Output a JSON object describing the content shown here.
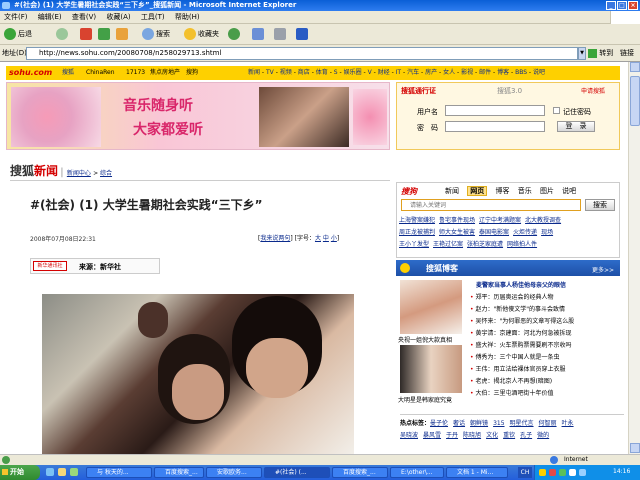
{
  "window": {
    "title": "#(社会) (1) 大学生暑期社会实践“三下乡”_搜狐新闻 - Microsoft Internet Explorer"
  },
  "menu": [
    "文件(F)",
    "编辑(E)",
    "查看(V)",
    "收藏(A)",
    "工具(T)",
    "帮助(H)"
  ],
  "toolbar": {
    "back": "后退",
    "search": "搜索",
    "favorites": "收藏夹"
  },
  "address": {
    "label": "地址(D)",
    "url": "http://news.sohu.com/20080708/n258029713.shtml",
    "go": "转到",
    "links": "链接"
  },
  "sohu": {
    "logo": "sohu.com",
    "search_label": "搜狐",
    "partners": [
      "ChinaRen",
      "17173",
      "焦点房地产",
      "搜狗"
    ],
    "nav": [
      "新闻",
      "TV",
      "视频",
      "商店",
      "体育",
      "S",
      "娱乐圈",
      "V",
      "财经",
      "IT",
      "汽车",
      "房产",
      "女人",
      "影视",
      "邮件",
      "博客",
      "BBS",
      "说吧"
    ]
  },
  "banner": {
    "line1": "音乐随身听",
    "line2": "大家都爱听"
  },
  "login": {
    "title": "搜狐通行证",
    "version": "搜狐3.0",
    "signup": "申请搜狐",
    "user_label": "用户名",
    "pass_label": "密　码",
    "remember": "记住密码",
    "login_button": "登　录"
  },
  "breadcrumb": {
    "brand1": "搜狐",
    "brand2": "新闻",
    "section": "新闻中心",
    "sub": "综合"
  },
  "article": {
    "title": "#(社会) (1) 大学生暑期社会实践“三下乡”",
    "date": "2008年07月08日22:31",
    "comment": "我来说两句",
    "font_label": "[字号：",
    "font_sizes": [
      "大",
      "中",
      "小"
    ],
    "source_badge": "新华通讯社",
    "source_label": "来源：新华社"
  },
  "search_box": {
    "brand": "搜狗",
    "tabs": [
      "新闻",
      "网页",
      "博客",
      "音乐",
      "图片",
      "说吧"
    ],
    "active_tab": "网页",
    "placeholder": "请输入关键词",
    "button": "搜索"
  },
  "hot_links": [
    [
      "上海警案嫌犯",
      "鲁宅事件现场",
      "辽宁中考满题案",
      "北大教授调查"
    ],
    [
      "周正龙被捕判",
      "师大女生被害",
      "泰国电影案",
      "火炬传递",
      "现场"
    ],
    [
      "王小丫发型",
      "王艳过亿案",
      "张柏芝家庭遭",
      "网络拍人件"
    ]
  ],
  "blog": {
    "title": "搜狐博客",
    "more": "更多>>",
    "headline": "麦警家当事人杨佳他母亲父的眼信",
    "caption1": "央视一姐倪大款真相",
    "caption2": "大明星是韩家庭究竟",
    "items": [
      "郑平：历届奥运会的经典人物",
      "赵力：\"新他傻文学\"的事斗会致情",
      "吴怀来：\"为何罪恶的文章写得这么股",
      "黄宇清：京建面：河北为何急被拆现",
      "盛大祥：火车票购票需要刷不宗收吗",
      "傅秀为：三个中国人就是一条虫",
      "王伟：用立法给裸体官员穿上衣服",
      "老虎：揭北京人不再想(暗图)",
      "大伯：三里屯酒吧街十年价值"
    ]
  },
  "hot_words": {
    "label": "热点标签：",
    "row1": [
      "曼子伦",
      "奢话",
      "朝鲜镜",
      "315",
      "明星代言",
      "何智丽",
      "叶永"
    ],
    "row2": [
      "吴晓波",
      "暴风雪",
      "于丹",
      "陈晓旭",
      "文化",
      "重钦",
      "孔子",
      "微的"
    ]
  },
  "status": {
    "zone": "Internet"
  },
  "taskbar": {
    "start": "开始",
    "tasks": [
      "与 秋天的...",
      "百度搜索_...",
      "安歌欧务...",
      "#(社会) (...",
      "百度搜索_...",
      "E:\\other\\...",
      "文档 1 - Mi..."
    ],
    "lang": "CH",
    "clock": "14:16"
  },
  "colors": {
    "xp_blue": "#2f7df0",
    "sohu_yellow": "#fed000",
    "link": "#0a2a8c",
    "red": "#d40000"
  }
}
